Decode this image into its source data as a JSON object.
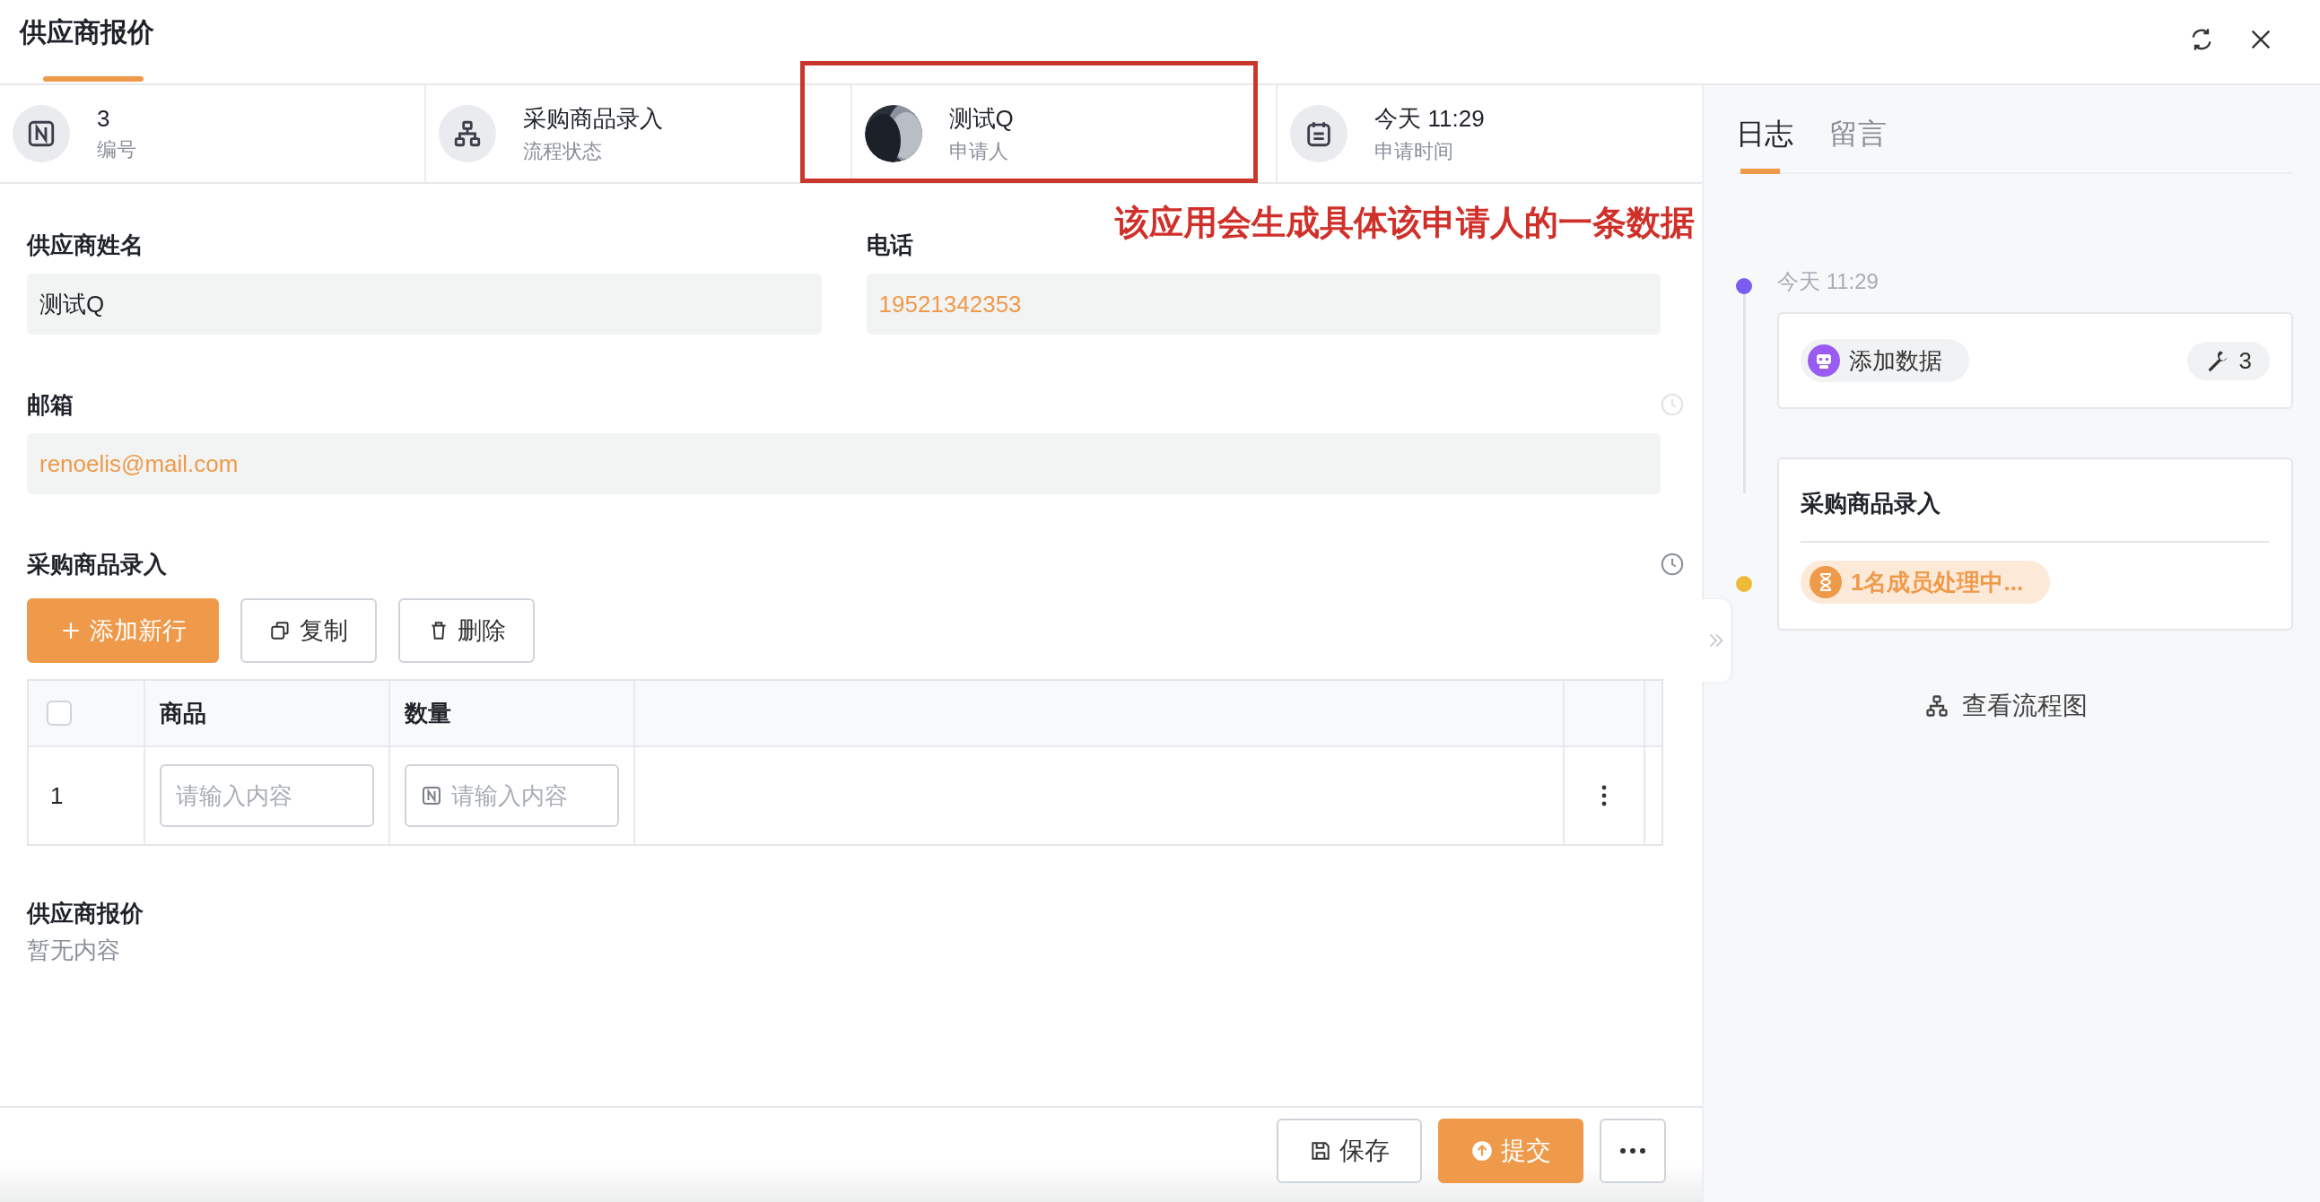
{
  "window": {
    "title": "供应商报价"
  },
  "header_actions": [
    {
      "kind": "refresh"
    },
    {
      "kind": "close"
    }
  ],
  "info_bar": [
    {
      "kind": "number",
      "value": "3",
      "label": "编号",
      "highlighted": false
    },
    {
      "kind": "flow",
      "value": "采购商品录入",
      "label": "流程状态",
      "highlighted": false
    },
    {
      "kind": "avatar",
      "value": "测试Q",
      "label": "申请人",
      "highlighted": true
    },
    {
      "kind": "time",
      "value": "今天 11:29",
      "label": "申请时间",
      "highlighted": false
    }
  ],
  "annotation": {
    "text": "该应用会生成具体该申请人的一条数据"
  },
  "form": {
    "fields": [
      {
        "label": "供应商姓名",
        "value": "测试Q",
        "kind": "text",
        "wide": false,
        "history": false
      },
      {
        "label": "电话",
        "value": "19521342353",
        "kind": "link",
        "wide": false,
        "history": false
      },
      {
        "label": "邮箱",
        "value": "renoelis@mail.com",
        "kind": "link",
        "wide": true,
        "history": true,
        "history_dim": true
      }
    ]
  },
  "subtable": {
    "title": "采购商品录入",
    "history": true,
    "buttons": [
      {
        "kind": "add",
        "label": "添加新行"
      },
      {
        "kind": "copy",
        "label": "复制"
      },
      {
        "kind": "delete",
        "label": "删除"
      }
    ],
    "header_checked": false,
    "columns": [
      "商品",
      "数量"
    ],
    "rows": [
      {
        "index": "1",
        "cells": [
          {
            "kind": "text",
            "placeholder": "请输入内容"
          },
          {
            "kind": "number",
            "placeholder": "请输入内容"
          }
        ]
      }
    ]
  },
  "section": {
    "title": "供应商报价",
    "empty_text": "暂无内容"
  },
  "footer_buttons": [
    {
      "kind": "save",
      "label": "保存"
    },
    {
      "kind": "submit",
      "label": "提交"
    },
    {
      "kind": "more"
    }
  ],
  "side": {
    "tabs": [
      {
        "label": "日志",
        "selected": true
      },
      {
        "label": "留言",
        "selected": false
      }
    ],
    "timeline": [
      {
        "kind": "action",
        "color": "#7b5cf0",
        "time": "今天 11:29",
        "badge": "添加数据",
        "count": "3"
      },
      {
        "kind": "step",
        "color": "#f0b93a",
        "title": "采购商品录入",
        "status": "1名成员处理中..."
      }
    ],
    "flow_link": "查看流程图"
  }
}
